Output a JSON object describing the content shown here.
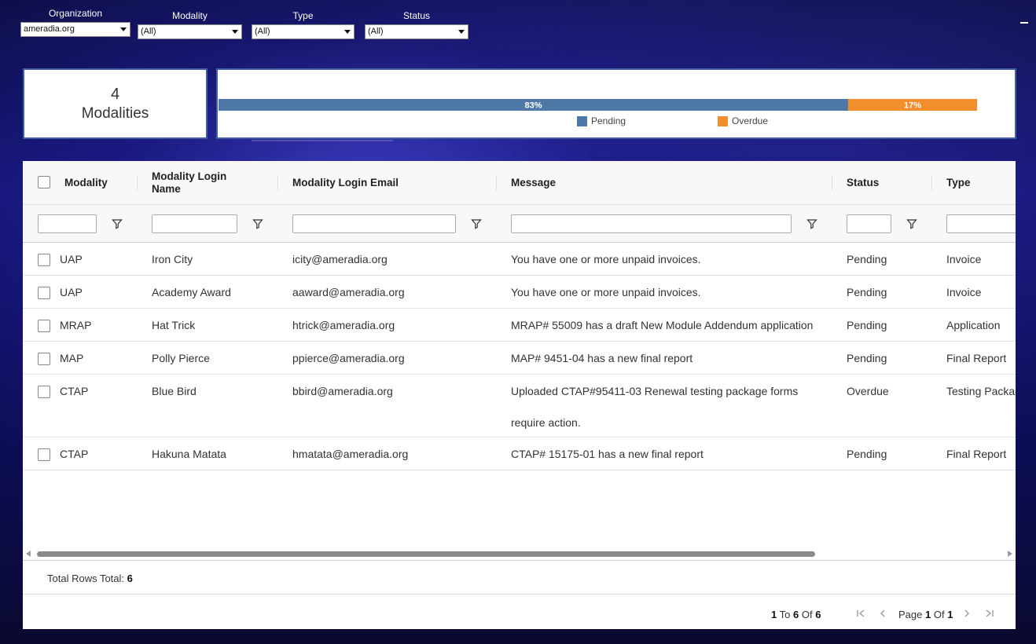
{
  "filters": [
    {
      "label": "Organization",
      "value": "ameradia.org"
    },
    {
      "label": "Modality",
      "value": "(All)"
    },
    {
      "label": "Type",
      "value": "(All)"
    },
    {
      "label": "Status",
      "value": "(All)"
    }
  ],
  "kpi": {
    "count": "4",
    "label": "Modalities"
  },
  "chart_data": {
    "type": "bar",
    "orientation": "horizontal-stacked",
    "series": [
      {
        "name": "Pending",
        "value": 83,
        "label": "83%",
        "color": "#4e79a7"
      },
      {
        "name": "Overdue",
        "value": 17,
        "label": "17%",
        "color": "#f28e2b"
      }
    ],
    "legend": "bottom"
  },
  "grid": {
    "columns": [
      {
        "key": "modality",
        "label": "Modality"
      },
      {
        "key": "login_name",
        "label": "Modality Login Name"
      },
      {
        "key": "login_email",
        "label": "Modality Login Email"
      },
      {
        "key": "message",
        "label": "Message"
      },
      {
        "key": "status",
        "label": "Status"
      },
      {
        "key": "type",
        "label": "Type"
      }
    ],
    "rows": [
      {
        "modality": "UAP",
        "login_name": "Iron City",
        "login_email": "icity@ameradia.org",
        "message": "You have one or more unpaid invoices.",
        "status": "Pending",
        "type": "Invoice"
      },
      {
        "modality": "UAP",
        "login_name": "Academy Award",
        "login_email": "aaward@ameradia.org",
        "message": "You have one or more unpaid invoices.",
        "status": "Pending",
        "type": "Invoice"
      },
      {
        "modality": "MRAP",
        "login_name": "Hat Trick",
        "login_email": "htrick@ameradia.org",
        "message": "MRAP# 55009 has a draft New Module Addendum application",
        "status": "Pending",
        "type": "Application"
      },
      {
        "modality": "MAP",
        "login_name": "Polly Pierce",
        "login_email": "ppierce@ameradia.org",
        "message": "MAP# 9451-04 has a new final report",
        "status": "Pending",
        "type": "Final Report"
      },
      {
        "modality": "CTAP",
        "login_name": "Blue Bird",
        "login_email": "bbird@ameradia.org",
        "message": "Uploaded CTAP#95411-03 Renewal testing package forms require action.",
        "status": "Overdue",
        "type": "Testing Packag"
      },
      {
        "modality": "CTAP",
        "login_name": "Hakuna Matata",
        "login_email": "hmatata@ameradia.org",
        "message": "CTAP# 15175-01 has a new final report",
        "status": "Pending",
        "type": "Final Report"
      }
    ],
    "total_label": "Total Rows Total:",
    "total_value": "6"
  },
  "pager": {
    "from": "1",
    "to_word": "To",
    "to": "6",
    "of_word": "Of",
    "total": "6",
    "page_word": "Page",
    "page": "1",
    "page_of_word": "Of",
    "page_total": "1"
  }
}
